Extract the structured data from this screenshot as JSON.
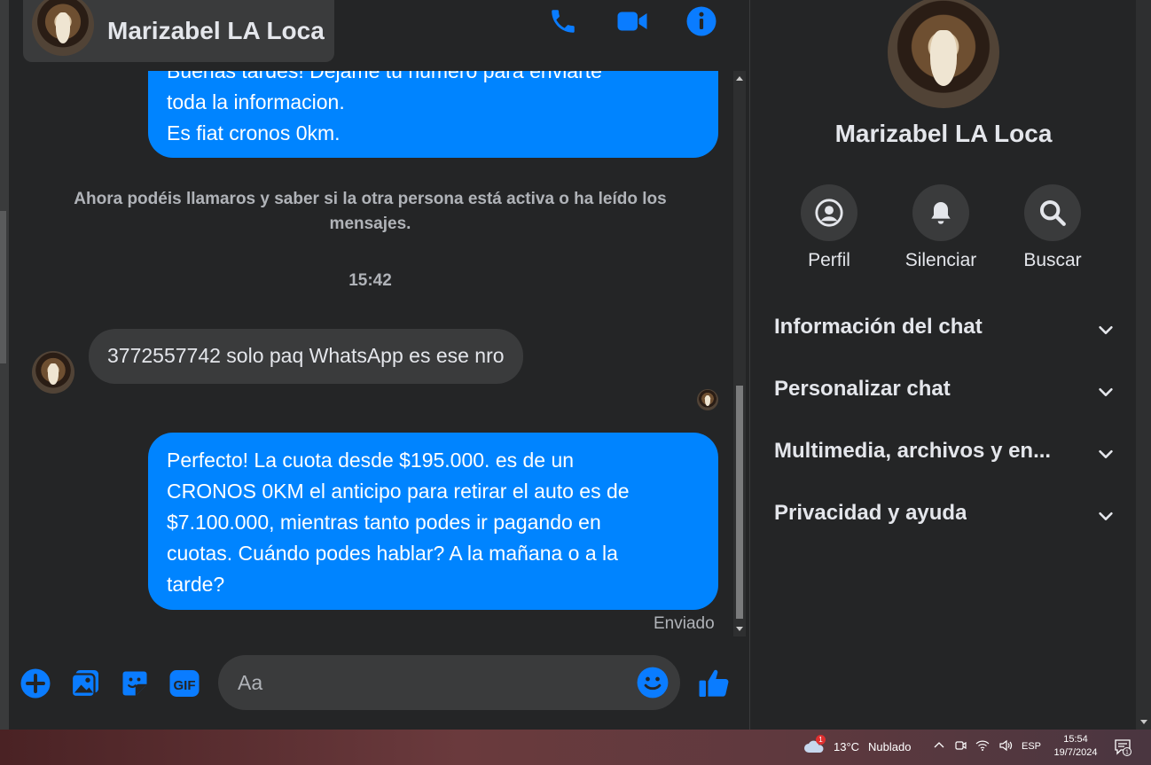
{
  "contact": {
    "name": "Marizabel LA Loca"
  },
  "messages": {
    "out1_lines": [
      "Buenas tardes! Dejame tu numero para enviarte",
      "toda la informacion.",
      "Es fiat cronos 0km."
    ],
    "system_notice": "Ahora podéis llamaros y saber si la otra persona está activa o ha leído los mensajes.",
    "timestamp": "15:42",
    "incoming": "3772557742 solo paq WhatsApp es ese nro",
    "out2_lines": [
      "Perfecto! La cuota desde $195.000. es de un",
      "CRONOS 0KM el anticipo para retirar el auto es de",
      "$7.100.000, mientras tanto podes ir pagando en",
      "cuotas. Cuándo podes hablar? A la mañana o a la",
      "tarde?"
    ],
    "status": "Enviado"
  },
  "composer": {
    "placeholder": "Aa"
  },
  "panel": {
    "actions": [
      {
        "label": "Perfil",
        "icon": "profile-icon"
      },
      {
        "label": "Silenciar",
        "icon": "bell-icon"
      },
      {
        "label": "Buscar",
        "icon": "search-icon"
      }
    ],
    "sections": [
      "Información del chat",
      "Personalizar chat",
      "Multimedia, archivos y en...",
      "Privacidad y ayuda"
    ]
  },
  "taskbar": {
    "weather_badge": "1",
    "temperature": "13°C",
    "condition": "Nublado",
    "language": "ESP",
    "time": "15:54",
    "date": "19/7/2024",
    "notif_count": "1"
  },
  "colors": {
    "accent": "#0084ff",
    "background": "#242526",
    "surface": "#3a3b3c"
  }
}
